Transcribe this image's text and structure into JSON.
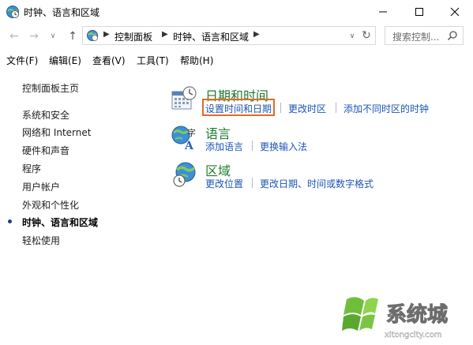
{
  "window": {
    "title": "时钟、语言和区域"
  },
  "address": {
    "breadcrumbs": [
      "控制面板",
      "时钟、语言和区域"
    ],
    "search_placeholder": "搜索控制...",
    "search_value": ""
  },
  "menu": {
    "items": [
      "文件(F)",
      "编辑(E)",
      "查看(V)",
      "工具(T)",
      "帮助(H)"
    ]
  },
  "sidebar": {
    "home": "控制面板主页",
    "items": [
      "系统和安全",
      "网络和 Internet",
      "硬件和声音",
      "程序",
      "用户帐户",
      "外观和个性化",
      "时钟、语言和区域",
      "轻松使用"
    ],
    "current": "时钟、语言和区域"
  },
  "groups": [
    {
      "title": "日期和时间",
      "icon": "calendar-clock-icon",
      "links": [
        "设置时间和日期",
        "更改时区",
        "添加不同时区的时钟"
      ]
    },
    {
      "title": "语言",
      "icon": "language-globe-icon",
      "links": [
        "添加语言",
        "更换输入法"
      ]
    },
    {
      "title": "区域",
      "icon": "region-globe-clock-icon",
      "links": [
        "更改位置",
        "更改日期、时间或数字格式"
      ]
    }
  ],
  "watermark": {
    "brand": "系统城",
    "domain": "xitongcity.com"
  },
  "colors": {
    "group_title": "#1e7b2d",
    "link": "#1b55b5",
    "highlight": "#e36a22"
  }
}
